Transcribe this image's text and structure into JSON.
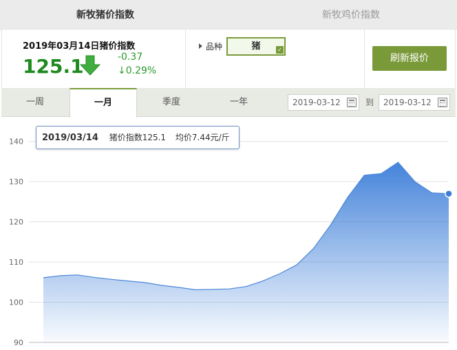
{
  "tabs": {
    "pig_index": "新牧猪价指数",
    "chicken_index": "新牧鸡价指数"
  },
  "summary": {
    "title": "2019年03月14日猪价指数",
    "value": "125.1",
    "change_abs": "-0.37",
    "change_pct": "↓0.29%"
  },
  "variety": {
    "label": "品种",
    "selected": "猪"
  },
  "refresh_button": "刷新报价",
  "range_tabs": [
    "一周",
    "一月",
    "季度",
    "一年"
  ],
  "date_range": {
    "from": "2019-03-12",
    "to_label": "到",
    "to": "2019-03-12"
  },
  "colors": {
    "accent": "#7a9a3a",
    "down": "#2a9a2a",
    "series": "#3b7dd8"
  },
  "tooltip": {
    "date": "2019/03/14",
    "index_text": "猪价指数125.1",
    "price_text": "均价7.44元/斤"
  },
  "chart_data": {
    "type": "area",
    "title": "",
    "xlabel": "",
    "ylabel": "",
    "ylim": [
      90,
      142
    ],
    "yticks": [
      90,
      100,
      110,
      120,
      130,
      140
    ],
    "grid": true,
    "series": [
      {
        "values": [
          106.1,
          106.6,
          106.8,
          106.2,
          105.7,
          105.3,
          104.9,
          104.2,
          103.7,
          103.1,
          103.2,
          103.3,
          103.9,
          105.3,
          107.1,
          109.3,
          113.4,
          119.2,
          126.0,
          131.6,
          132.0,
          134.8,
          130.0,
          127.2,
          127.0
        ]
      }
    ]
  }
}
